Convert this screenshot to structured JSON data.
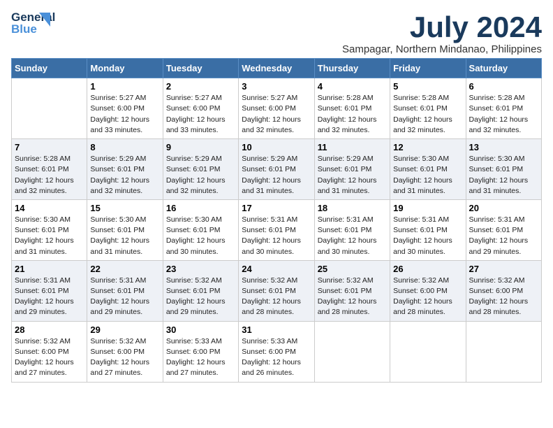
{
  "logo": {
    "line1": "General",
    "line2": "Blue",
    "tagline": ""
  },
  "title": "July 2024",
  "subtitle": "Sampagar, Northern Mindanao, Philippines",
  "days_header": [
    "Sunday",
    "Monday",
    "Tuesday",
    "Wednesday",
    "Thursday",
    "Friday",
    "Saturday"
  ],
  "weeks": [
    [
      {
        "num": "",
        "sunrise": "",
        "sunset": "",
        "daylight": ""
      },
      {
        "num": "1",
        "sunrise": "Sunrise: 5:27 AM",
        "sunset": "Sunset: 6:00 PM",
        "daylight": "Daylight: 12 hours and 33 minutes."
      },
      {
        "num": "2",
        "sunrise": "Sunrise: 5:27 AM",
        "sunset": "Sunset: 6:00 PM",
        "daylight": "Daylight: 12 hours and 33 minutes."
      },
      {
        "num": "3",
        "sunrise": "Sunrise: 5:27 AM",
        "sunset": "Sunset: 6:00 PM",
        "daylight": "Daylight: 12 hours and 32 minutes."
      },
      {
        "num": "4",
        "sunrise": "Sunrise: 5:28 AM",
        "sunset": "Sunset: 6:01 PM",
        "daylight": "Daylight: 12 hours and 32 minutes."
      },
      {
        "num": "5",
        "sunrise": "Sunrise: 5:28 AM",
        "sunset": "Sunset: 6:01 PM",
        "daylight": "Daylight: 12 hours and 32 minutes."
      },
      {
        "num": "6",
        "sunrise": "Sunrise: 5:28 AM",
        "sunset": "Sunset: 6:01 PM",
        "daylight": "Daylight: 12 hours and 32 minutes."
      }
    ],
    [
      {
        "num": "7",
        "sunrise": "Sunrise: 5:28 AM",
        "sunset": "Sunset: 6:01 PM",
        "daylight": "Daylight: 12 hours and 32 minutes."
      },
      {
        "num": "8",
        "sunrise": "Sunrise: 5:29 AM",
        "sunset": "Sunset: 6:01 PM",
        "daylight": "Daylight: 12 hours and 32 minutes."
      },
      {
        "num": "9",
        "sunrise": "Sunrise: 5:29 AM",
        "sunset": "Sunset: 6:01 PM",
        "daylight": "Daylight: 12 hours and 32 minutes."
      },
      {
        "num": "10",
        "sunrise": "Sunrise: 5:29 AM",
        "sunset": "Sunset: 6:01 PM",
        "daylight": "Daylight: 12 hours and 31 minutes."
      },
      {
        "num": "11",
        "sunrise": "Sunrise: 5:29 AM",
        "sunset": "Sunset: 6:01 PM",
        "daylight": "Daylight: 12 hours and 31 minutes."
      },
      {
        "num": "12",
        "sunrise": "Sunrise: 5:30 AM",
        "sunset": "Sunset: 6:01 PM",
        "daylight": "Daylight: 12 hours and 31 minutes."
      },
      {
        "num": "13",
        "sunrise": "Sunrise: 5:30 AM",
        "sunset": "Sunset: 6:01 PM",
        "daylight": "Daylight: 12 hours and 31 minutes."
      }
    ],
    [
      {
        "num": "14",
        "sunrise": "Sunrise: 5:30 AM",
        "sunset": "Sunset: 6:01 PM",
        "daylight": "Daylight: 12 hours and 31 minutes."
      },
      {
        "num": "15",
        "sunrise": "Sunrise: 5:30 AM",
        "sunset": "Sunset: 6:01 PM",
        "daylight": "Daylight: 12 hours and 31 minutes."
      },
      {
        "num": "16",
        "sunrise": "Sunrise: 5:30 AM",
        "sunset": "Sunset: 6:01 PM",
        "daylight": "Daylight: 12 hours and 30 minutes."
      },
      {
        "num": "17",
        "sunrise": "Sunrise: 5:31 AM",
        "sunset": "Sunset: 6:01 PM",
        "daylight": "Daylight: 12 hours and 30 minutes."
      },
      {
        "num": "18",
        "sunrise": "Sunrise: 5:31 AM",
        "sunset": "Sunset: 6:01 PM",
        "daylight": "Daylight: 12 hours and 30 minutes."
      },
      {
        "num": "19",
        "sunrise": "Sunrise: 5:31 AM",
        "sunset": "Sunset: 6:01 PM",
        "daylight": "Daylight: 12 hours and 30 minutes."
      },
      {
        "num": "20",
        "sunrise": "Sunrise: 5:31 AM",
        "sunset": "Sunset: 6:01 PM",
        "daylight": "Daylight: 12 hours and 29 minutes."
      }
    ],
    [
      {
        "num": "21",
        "sunrise": "Sunrise: 5:31 AM",
        "sunset": "Sunset: 6:01 PM",
        "daylight": "Daylight: 12 hours and 29 minutes."
      },
      {
        "num": "22",
        "sunrise": "Sunrise: 5:31 AM",
        "sunset": "Sunset: 6:01 PM",
        "daylight": "Daylight: 12 hours and 29 minutes."
      },
      {
        "num": "23",
        "sunrise": "Sunrise: 5:32 AM",
        "sunset": "Sunset: 6:01 PM",
        "daylight": "Daylight: 12 hours and 29 minutes."
      },
      {
        "num": "24",
        "sunrise": "Sunrise: 5:32 AM",
        "sunset": "Sunset: 6:01 PM",
        "daylight": "Daylight: 12 hours and 28 minutes."
      },
      {
        "num": "25",
        "sunrise": "Sunrise: 5:32 AM",
        "sunset": "Sunset: 6:01 PM",
        "daylight": "Daylight: 12 hours and 28 minutes."
      },
      {
        "num": "26",
        "sunrise": "Sunrise: 5:32 AM",
        "sunset": "Sunset: 6:00 PM",
        "daylight": "Daylight: 12 hours and 28 minutes."
      },
      {
        "num": "27",
        "sunrise": "Sunrise: 5:32 AM",
        "sunset": "Sunset: 6:00 PM",
        "daylight": "Daylight: 12 hours and 28 minutes."
      }
    ],
    [
      {
        "num": "28",
        "sunrise": "Sunrise: 5:32 AM",
        "sunset": "Sunset: 6:00 PM",
        "daylight": "Daylight: 12 hours and 27 minutes."
      },
      {
        "num": "29",
        "sunrise": "Sunrise: 5:32 AM",
        "sunset": "Sunset: 6:00 PM",
        "daylight": "Daylight: 12 hours and 27 minutes."
      },
      {
        "num": "30",
        "sunrise": "Sunrise: 5:33 AM",
        "sunset": "Sunset: 6:00 PM",
        "daylight": "Daylight: 12 hours and 27 minutes."
      },
      {
        "num": "31",
        "sunrise": "Sunrise: 5:33 AM",
        "sunset": "Sunset: 6:00 PM",
        "daylight": "Daylight: 12 hours and 26 minutes."
      },
      {
        "num": "",
        "sunrise": "",
        "sunset": "",
        "daylight": ""
      },
      {
        "num": "",
        "sunrise": "",
        "sunset": "",
        "daylight": ""
      },
      {
        "num": "",
        "sunrise": "",
        "sunset": "",
        "daylight": ""
      }
    ]
  ]
}
